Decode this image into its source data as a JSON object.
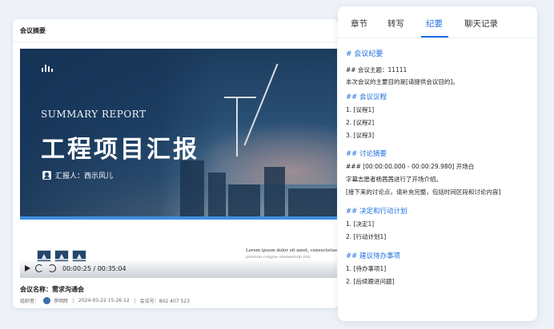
{
  "left_panel": {
    "title": "会议摘要",
    "slide": {
      "english_title": "SUMMARY REPORT",
      "chinese_title": "工程项目汇报",
      "reporter": "汇报人：西示风儿",
      "lorem_line1": "Lorem ipsum dolor sit amet, consectetuer adi",
      "lorem_line2": "pretium congue elementum nisi"
    },
    "player": {
      "current_time": "00:00:25",
      "total_time": "00:35:04",
      "time_display": "00:00:25 / 00:35:04",
      "progress_fraction": 0.012
    },
    "meeting_name": "会议名称：需求沟通会",
    "organizer_label": "组织者：",
    "organizer_name": "李明辉",
    "datetime": "2024-03-22 15:26:12",
    "meeting_id": "会议号：802 407 523"
  },
  "right_panel": {
    "tabs": [
      {
        "label": "章节",
        "active": false
      },
      {
        "label": "转写",
        "active": false
      },
      {
        "label": "纪要",
        "active": true
      },
      {
        "label": "聊天记录",
        "active": false
      }
    ],
    "lines": [
      {
        "text": "# 会议纪要",
        "style": "h1"
      },
      {
        "text": "## 会议主题：11111",
        "style": "body"
      },
      {
        "text": "本次会议的主要目的是[请提供会议目的]。",
        "style": "body"
      },
      {
        "text": "## 会议议程",
        "style": "h2"
      },
      {
        "text": "1. [议程1]",
        "style": "body"
      },
      {
        "text": "2. [议程2]",
        "style": "body"
      },
      {
        "text": "3. [议程3]",
        "style": "body"
      },
      {
        "text": "## 讨论摘要",
        "style": "h2"
      },
      {
        "text": "### [00:00:00.000 - 00:00:29.980] 开场白",
        "style": "body"
      },
      {
        "text": "字幕志愿者杨茜茜进行了开场介绍。",
        "style": "body"
      },
      {
        "text": "[接下来的讨论点，请补充完整，包括时间区段和讨论内容]",
        "style": "body"
      },
      {
        "text": "## 决定和行动计划",
        "style": "h2"
      },
      {
        "text": "1. [决定1]",
        "style": "body"
      },
      {
        "text": "2. [行动计划1]",
        "style": "body"
      },
      {
        "text": "## 建议待办事项",
        "style": "h2"
      },
      {
        "text": "1. [待办事项1]",
        "style": "body"
      },
      {
        "text": "2. [后续跟进问题]",
        "style": "body"
      }
    ]
  },
  "colors": {
    "accent": "#1d6fe0",
    "background": "#eef2f8",
    "slide_dark": "#1c3c5e"
  }
}
